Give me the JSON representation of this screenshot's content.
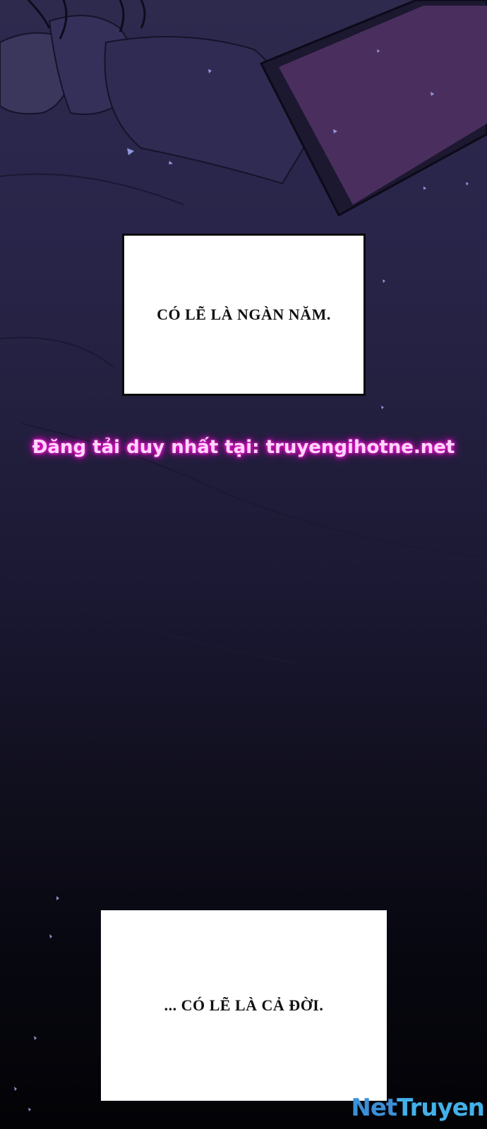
{
  "panel": {
    "caption_top": "CÓ LẼ LÀ NGÀN NĂM.",
    "caption_bottom": "... CÓ LẼ LÀ CẢ ĐỜI."
  },
  "watermark": {
    "text": "Đăng tải duy nhất tại: truyengihotne.net",
    "glow_color": "#e600c8"
  },
  "logo": {
    "net": "Net",
    "truyen": "Truyen"
  },
  "colors": {
    "background_top": "#2e2a4e",
    "background_bottom": "#030306",
    "caption_bg": "#ffffff",
    "caption_text": "#111111"
  }
}
